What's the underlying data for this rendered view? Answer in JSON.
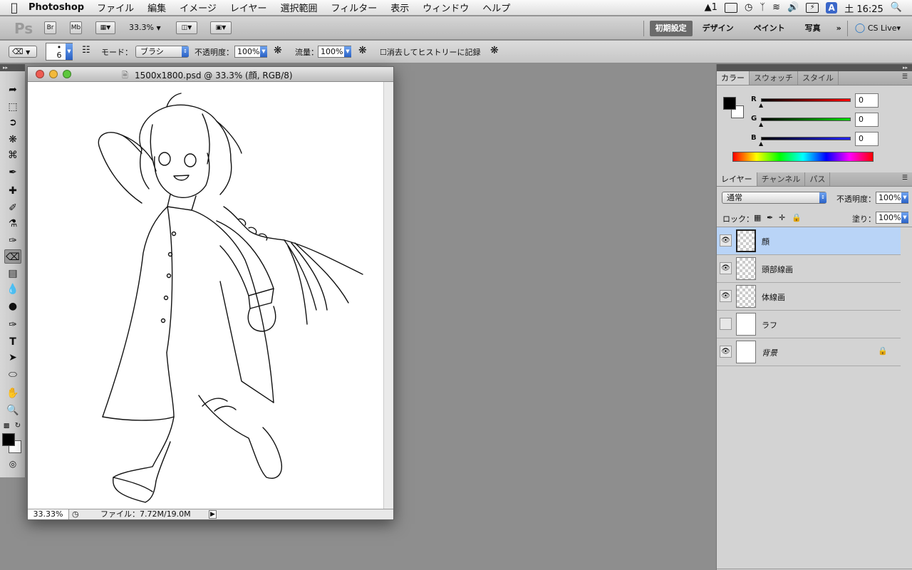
{
  "menubar": {
    "apple": "",
    "app_name": "Photoshop",
    "menus": [
      "ファイル",
      "編集",
      "イメージ",
      "レイヤー",
      "選択範囲",
      "フィルター",
      "表示",
      "ウィンドウ",
      "ヘルプ"
    ],
    "status": {
      "adobe_badge": "1",
      "input_method": "A",
      "clock": "土 16:25"
    }
  },
  "appbar": {
    "logo": "Ps",
    "bridge": "Br",
    "mini_bridge": "Mb",
    "zoom": "33.3%",
    "workspaces": [
      "初期設定",
      "デザイン",
      "ペイント",
      "写真"
    ],
    "more": "»",
    "cs_live": "CS Live"
  },
  "options": {
    "brush_size": "6",
    "mode_label": "モード：",
    "mode_value": "ブラシ",
    "opacity_label": "不透明度：",
    "opacity_value": "100%",
    "flow_label": "流量：",
    "flow_value": "100%",
    "history_label": "消去してヒストリーに記録"
  },
  "document": {
    "title": "1500x1800.psd @ 33.3% (顔, RGB/8)",
    "zoom": "33.33%",
    "file_info": "ファイル：7.72M/19.0M"
  },
  "color_panel": {
    "tabs": [
      "カラー",
      "スウォッチ",
      "スタイル"
    ],
    "channels": [
      {
        "label": "R",
        "value": "0",
        "color": "#e00000"
      },
      {
        "label": "G",
        "value": "0",
        "color": "#00c000"
      },
      {
        "label": "B",
        "value": "0",
        "color": "#2020e0"
      }
    ]
  },
  "layers_panel": {
    "tabs": [
      "レイヤー",
      "チャンネル",
      "パス"
    ],
    "blend_mode": "通常",
    "opacity_label": "不透明度：",
    "opacity_value": "100%",
    "lock_label": "ロック：",
    "fill_label": "塗り：",
    "fill_value": "100%",
    "layers": [
      {
        "name": "顔",
        "visible": true,
        "selected": true
      },
      {
        "name": "頭部線画",
        "visible": true,
        "selected": false
      },
      {
        "name": "体線画",
        "visible": true,
        "selected": false
      },
      {
        "name": "ラフ",
        "visible": false,
        "selected": false
      },
      {
        "name": "背景",
        "visible": true,
        "selected": false,
        "locked": true
      }
    ]
  }
}
